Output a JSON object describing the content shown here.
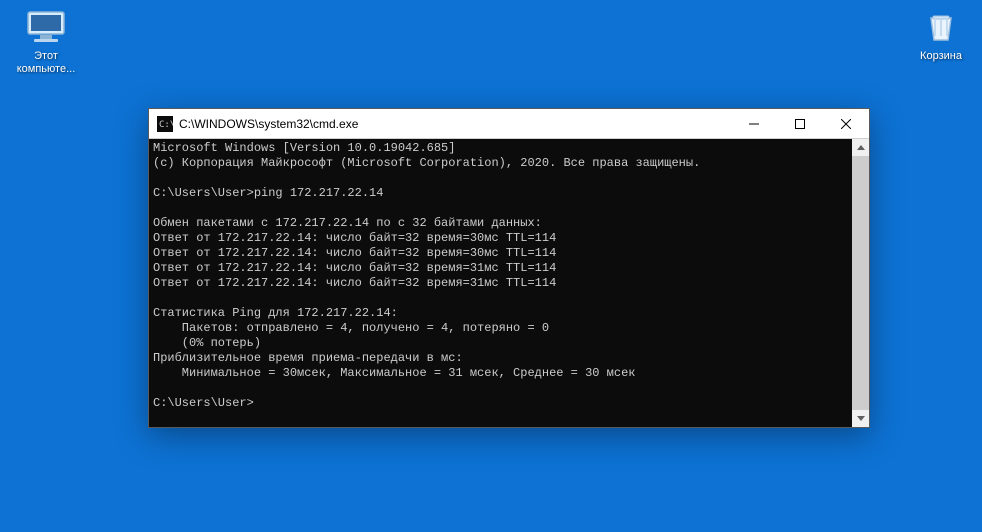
{
  "desktop": {
    "icons": {
      "computer": {
        "label": "Этот компьюте..."
      },
      "recycle": {
        "label": "Корзина"
      }
    }
  },
  "window": {
    "title": "C:\\WINDOWS\\system32\\cmd.exe"
  },
  "terminal": {
    "lines": [
      "Microsoft Windows [Version 10.0.19042.685]",
      "(c) Корпорация Майкрософт (Microsoft Corporation), 2020. Все права защищены.",
      "",
      "C:\\Users\\User>ping 172.217.22.14",
      "",
      "Обмен пакетами с 172.217.22.14 по с 32 байтами данных:",
      "Ответ от 172.217.22.14: число байт=32 время=30мс TTL=114",
      "Ответ от 172.217.22.14: число байт=32 время=30мс TTL=114",
      "Ответ от 172.217.22.14: число байт=32 время=31мс TTL=114",
      "Ответ от 172.217.22.14: число байт=32 время=31мс TTL=114",
      "",
      "Статистика Ping для 172.217.22.14:",
      "    Пакетов: отправлено = 4, получено = 4, потеряно = 0",
      "    (0% потерь)",
      "Приблизительное время приема-передачи в мс:",
      "    Минимальное = 30мсек, Максимальное = 31 мсек, Среднее = 30 мсек",
      "",
      "C:\\Users\\User>"
    ]
  }
}
